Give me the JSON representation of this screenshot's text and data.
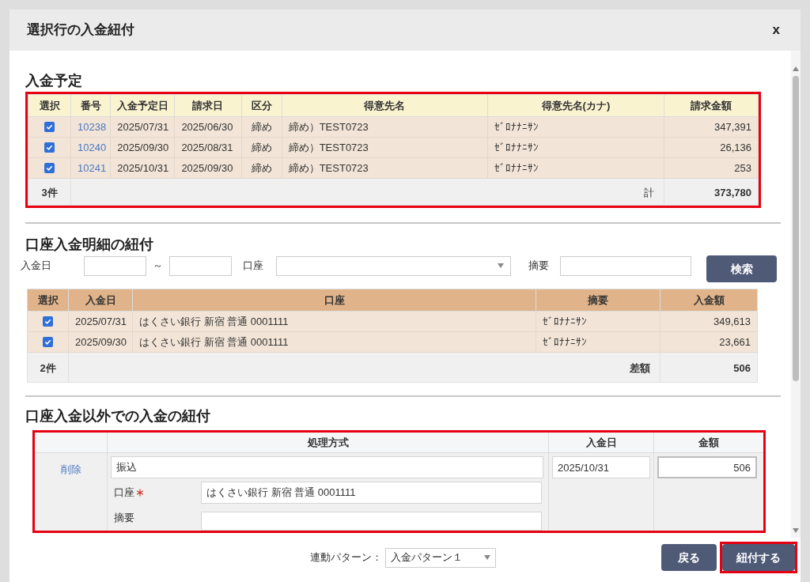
{
  "dialog": {
    "title": "選択行の入金紐付",
    "close": "x"
  },
  "scheduled": {
    "heading": "入金予定",
    "highlighted": true,
    "columns": [
      "選択",
      "番号",
      "入金予定日",
      "請求日",
      "区分",
      "得意先名",
      "得意先名(カナ)",
      "請求金額"
    ],
    "rows": [
      {
        "checked": true,
        "number": "10238",
        "due_date": "2025/07/31",
        "invoice_date": "2025/06/30",
        "category": "締め",
        "customer": "締め）TEST0723",
        "kana": "ｾﾞﾛﾅﾅﾆｻﾝ",
        "amount": "347,391"
      },
      {
        "checked": true,
        "number": "10240",
        "due_date": "2025/09/30",
        "invoice_date": "2025/08/31",
        "category": "締め",
        "customer": "締め）TEST0723",
        "kana": "ｾﾞﾛﾅﾅﾆｻﾝ",
        "amount": "26,136"
      },
      {
        "checked": true,
        "number": "10241",
        "due_date": "2025/10/31",
        "invoice_date": "2025/09/30",
        "category": "締め",
        "customer": "締め）TEST0723",
        "kana": "ｾﾞﾛﾅﾅﾆｻﾝ",
        "amount": "253"
      }
    ],
    "footer": {
      "count": "3件",
      "label": "計",
      "total": "373,780"
    }
  },
  "bank": {
    "heading": "口座入金明細の紐付",
    "filter": {
      "date_label": "入金日",
      "range_sep": "～",
      "account_label": "口座",
      "memo_label": "摘要",
      "search_button": "検索"
    },
    "columns": [
      "選択",
      "入金日",
      "口座",
      "摘要",
      "入金額"
    ],
    "rows": [
      {
        "checked": true,
        "date": "2025/07/31",
        "account": "はくさい銀行 新宿 普通 0001111",
        "memo": "ｾﾞﾛﾅﾅﾆｻﾝ",
        "amount": "349,613"
      },
      {
        "checked": true,
        "date": "2025/09/30",
        "account": "はくさい銀行 新宿 普通 0001111",
        "memo": "ｾﾞﾛﾅﾅﾆｻﾝ",
        "amount": "23,661"
      }
    ],
    "footer": {
      "count": "2件",
      "label": "差額",
      "total": "506"
    }
  },
  "other": {
    "heading": "口座入金以外での入金の紐付",
    "highlighted": true,
    "columns": [
      "処理方式",
      "入金日",
      "金額"
    ],
    "row": {
      "delete_link": "削除",
      "method": "振込",
      "date": "2025/10/31",
      "amount": "506",
      "fields": [
        {
          "label": "口座",
          "required": true,
          "value": "はくさい銀行 新宿 普通 0001111"
        },
        {
          "label": "摘要",
          "required": false
        }
      ]
    }
  },
  "footer": {
    "pattern_label": "連動パターン：",
    "pattern_value": "入金パターン１",
    "buttons": [
      {
        "label": "戻る",
        "highlighted": false
      },
      {
        "label": "紐付する",
        "highlighted": true
      }
    ]
  }
}
